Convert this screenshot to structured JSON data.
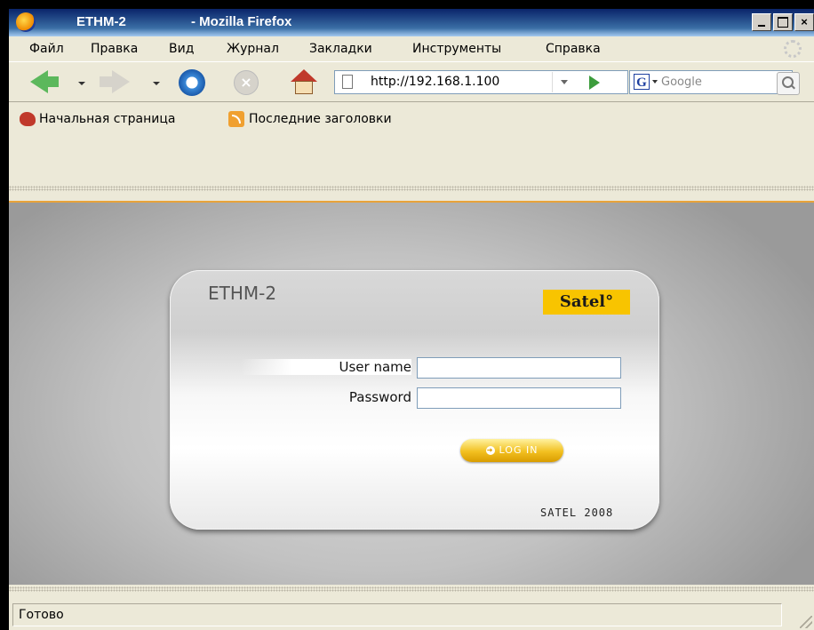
{
  "window": {
    "app_name": "ETHM-2",
    "title_suffix": "- Mozilla Firefox",
    "controls": [
      "_",
      "□",
      "×"
    ]
  },
  "menu": [
    "Файл",
    "Правка",
    "Вид",
    "Журнал",
    "Закладки",
    "Инструменты",
    "Справка"
  ],
  "navigation": {
    "url": "http://192.168.1.100",
    "search_placeholder": "Google"
  },
  "bookmarks": [
    "Начальная страница",
    "Последние заголовки"
  ],
  "login_panel": {
    "title": "ETHM-2",
    "brand": "Satel°",
    "user_label": "User name",
    "password_label": "Password",
    "user_value": "",
    "password_value": "",
    "button_label": "LOG IN",
    "footer": "SATEL 2008"
  },
  "colors": {
    "brand_yellow": "#f8c400",
    "accent_orange": "#e8a33a"
  },
  "status": {
    "text": "Готово"
  }
}
